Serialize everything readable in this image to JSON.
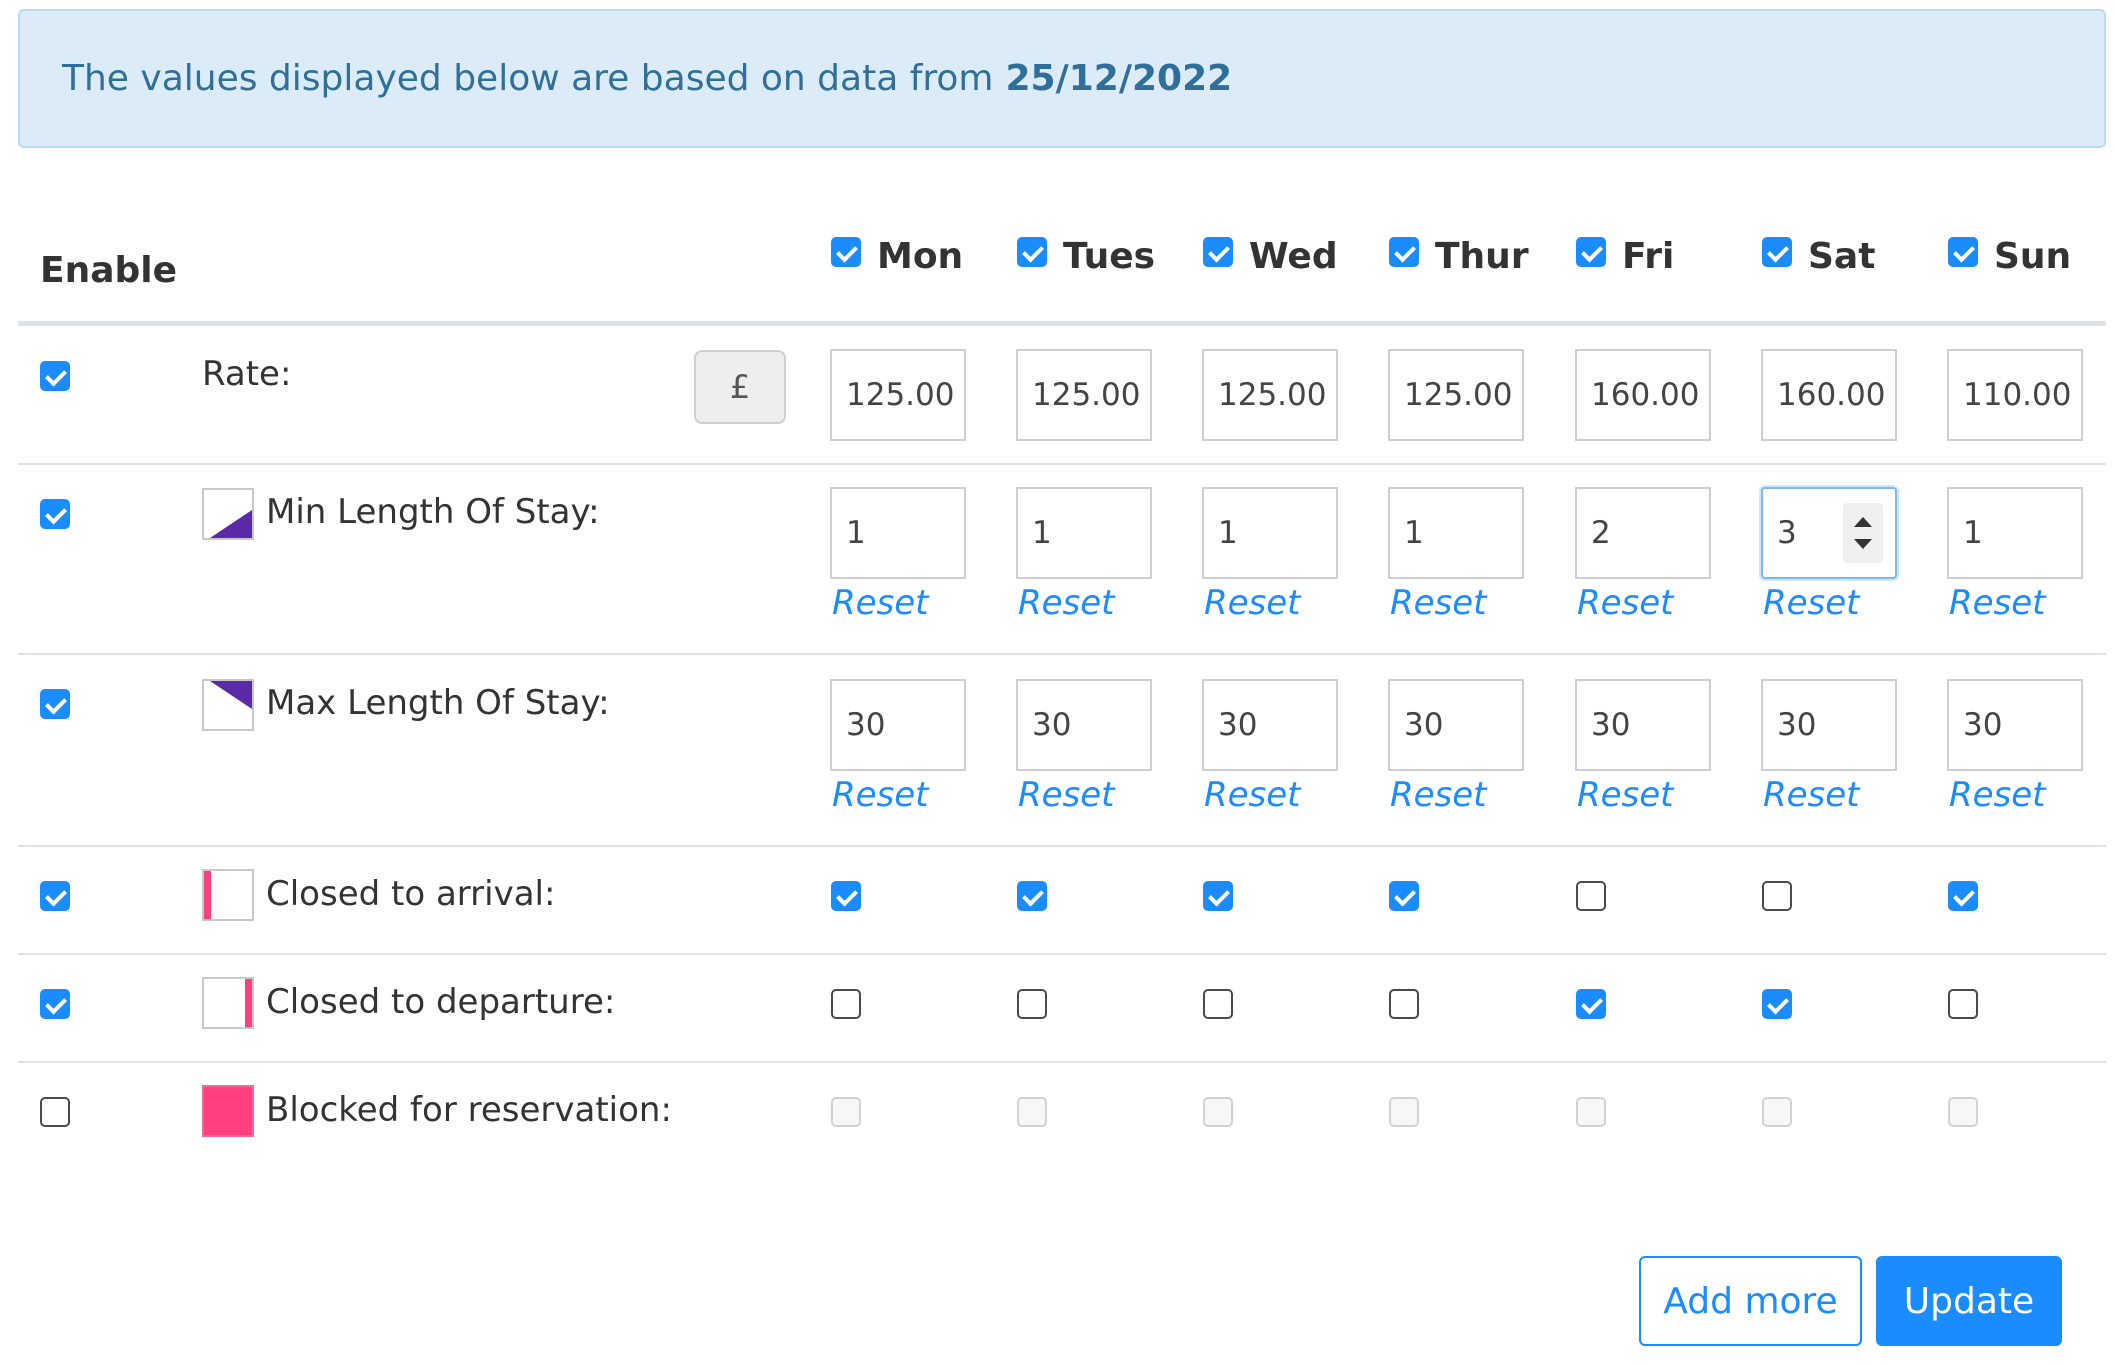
{
  "banner": {
    "text": "The values displayed below are based on data from",
    "date": "25/12/2022"
  },
  "header": {
    "enable_label": "Enable",
    "days": [
      {
        "label": "Mon",
        "checked": true
      },
      {
        "label": "Tues",
        "checked": true
      },
      {
        "label": "Wed",
        "checked": true
      },
      {
        "label": "Thur",
        "checked": true
      },
      {
        "label": "Fri",
        "checked": true
      },
      {
        "label": "Sat",
        "checked": true
      },
      {
        "label": "Sun",
        "checked": true
      }
    ]
  },
  "rate": {
    "label": "Rate:",
    "enabled": true,
    "currency_symbol": "£",
    "values": [
      "125.00",
      "125.00",
      "125.00",
      "125.00",
      "160.00",
      "160.00",
      "110.00"
    ]
  },
  "min_stay": {
    "label": "Min Length Of Stay:",
    "enabled": true,
    "legend_color": "#5b2aa8",
    "values": [
      "1",
      "1",
      "1",
      "1",
      "2",
      "3",
      "1"
    ],
    "reset_label": "Reset"
  },
  "max_stay": {
    "label": "Max Length Of Stay:",
    "enabled": true,
    "legend_color": "#5b2aa8",
    "values": [
      "30",
      "30",
      "30",
      "30",
      "30",
      "30",
      "30"
    ],
    "reset_label": "Reset"
  },
  "closed_arrival": {
    "label": "Closed to arrival:",
    "enabled": true,
    "legend_color": "#ff3f7f",
    "days": [
      true,
      true,
      true,
      true,
      false,
      false,
      true
    ]
  },
  "closed_departure": {
    "label": "Closed to departure:",
    "enabled": true,
    "legend_color": "#ff3f7f",
    "days": [
      false,
      false,
      false,
      false,
      true,
      true,
      false
    ]
  },
  "blocked": {
    "label": "Blocked for reservation:",
    "enabled": false,
    "legend_color": "#ff3f7f",
    "days": [
      false,
      false,
      false,
      false,
      false,
      false,
      false
    ]
  },
  "actions": {
    "add_more": "Add more",
    "update": "Update"
  },
  "colors": {
    "accent": "#1a8cff",
    "banner_bg": "#dbecf8",
    "banner_text": "#2f6f9a"
  }
}
